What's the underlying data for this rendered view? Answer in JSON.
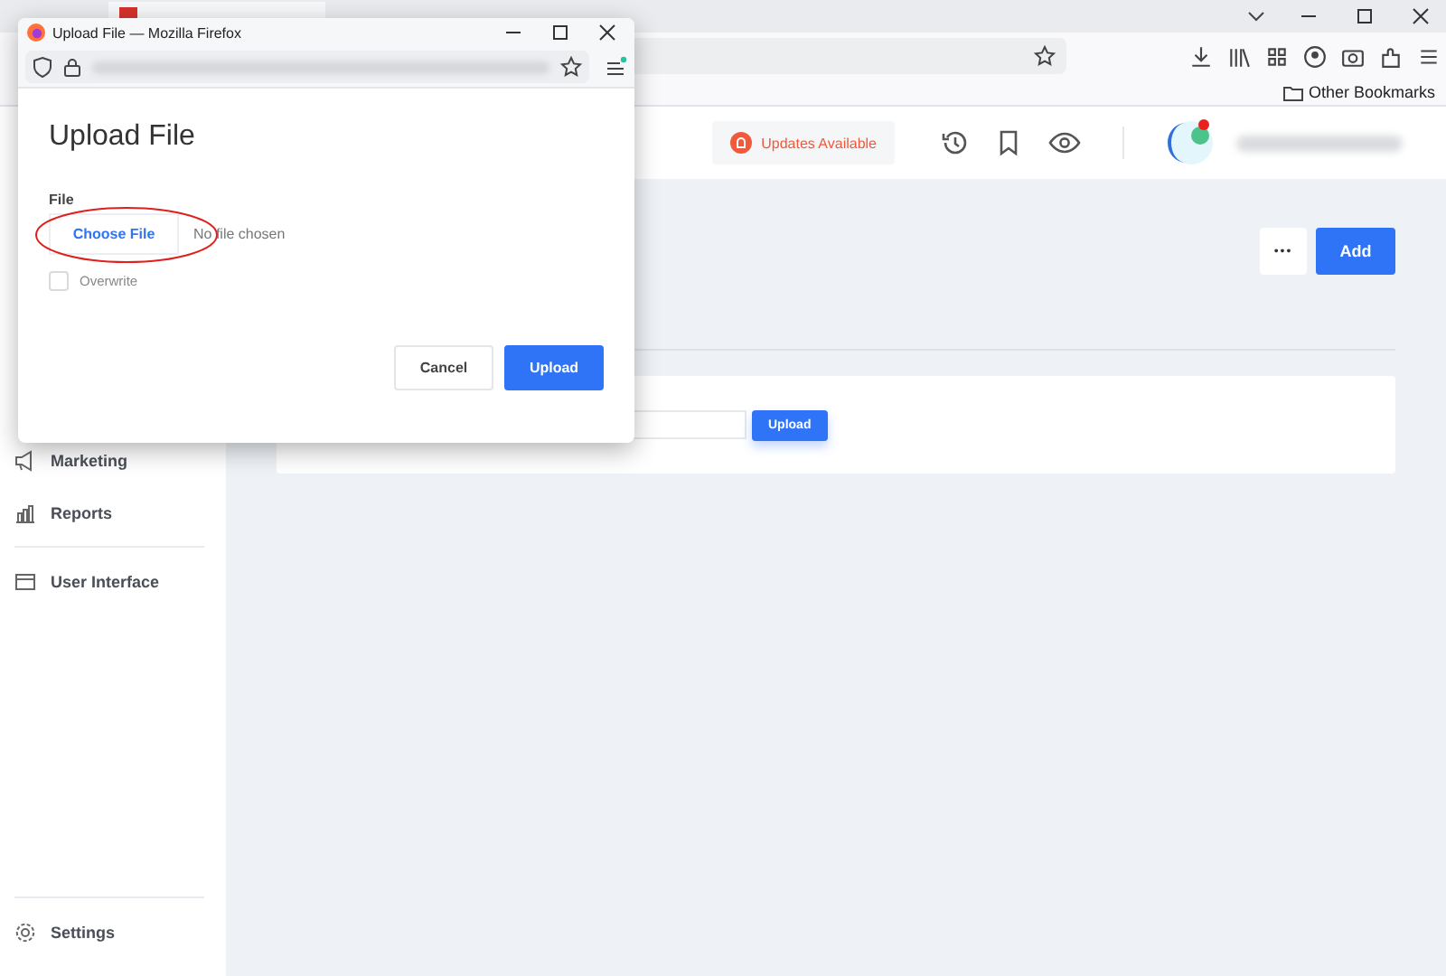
{
  "browser": {
    "bookmarks_bar": {
      "label": "Other Bookmarks"
    }
  },
  "header": {
    "updates": {
      "label": "Updates Available"
    }
  },
  "sidebar": {
    "items": [
      {
        "label": "Marketing"
      },
      {
        "label": "Reports"
      },
      {
        "label": "User Interface"
      }
    ],
    "footer": {
      "label": "Settings"
    }
  },
  "content": {
    "actions": {
      "more": "•••",
      "add": "Add"
    },
    "card": {
      "upload_button": "Upload"
    }
  },
  "popup": {
    "window_title": "Upload File — Mozilla Firefox",
    "title": "Upload File",
    "field_label": "File",
    "choose_button": "Choose File",
    "file_status": "No file chosen",
    "overwrite": {
      "label": "Overwrite",
      "checked": false
    },
    "buttons": [
      {
        "label": "Cancel",
        "kind": "secondary"
      },
      {
        "label": "Upload",
        "kind": "primary"
      }
    ]
  }
}
